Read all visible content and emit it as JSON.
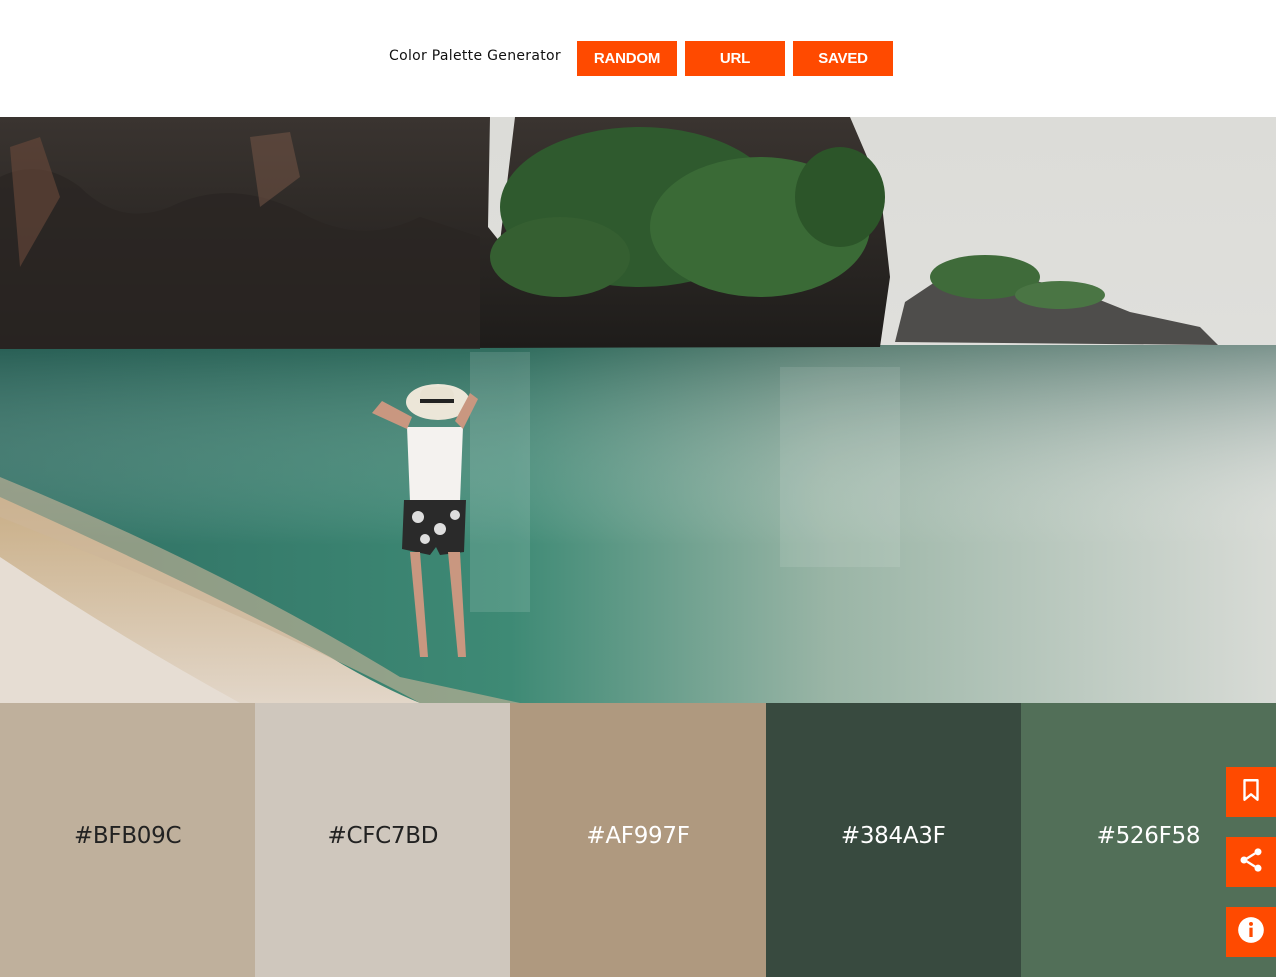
{
  "header": {
    "title": "Color Palette Generator",
    "buttons": {
      "random": "RANDOM",
      "url": "URL",
      "saved": "SAVED"
    },
    "accent": "#ff4a00"
  },
  "photo": {
    "icon": "beach-photo"
  },
  "palette": {
    "swatches": [
      {
        "hex": "#BFB09C",
        "color": "#BFB09C",
        "text_color": "#222222"
      },
      {
        "hex": "#CFC7BD",
        "color": "#CFC7BD",
        "text_color": "#222222"
      },
      {
        "hex": "#AF997F",
        "color": "#AF997F",
        "text_color": "#ffffff"
      },
      {
        "hex": "#384A3F",
        "color": "#384A3F",
        "text_color": "#ffffff"
      },
      {
        "hex": "#526F58",
        "color": "#526F58",
        "text_color": "#ffffff"
      }
    ]
  },
  "side_actions": {
    "icons": [
      "bookmark-icon",
      "share-icon",
      "info-icon"
    ]
  }
}
